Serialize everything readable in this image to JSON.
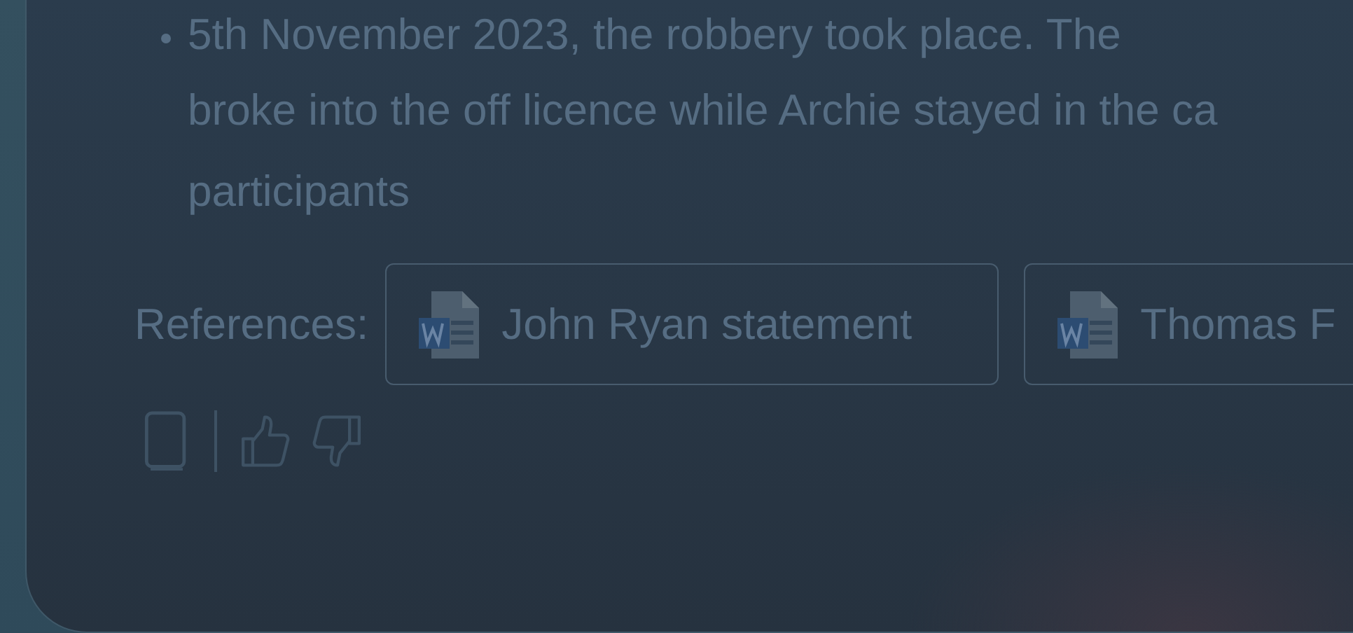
{
  "answer": {
    "bullet_lines": [
      "5th November 2023, the robbery took place. The",
      "broke into the off licence while Archie stayed in the ca",
      "participants"
    ]
  },
  "references": {
    "label": "References:",
    "items": [
      {
        "title": "John Ryan statement",
        "kind": "word"
      },
      {
        "title": "Thomas F",
        "kind": "word"
      }
    ]
  }
}
